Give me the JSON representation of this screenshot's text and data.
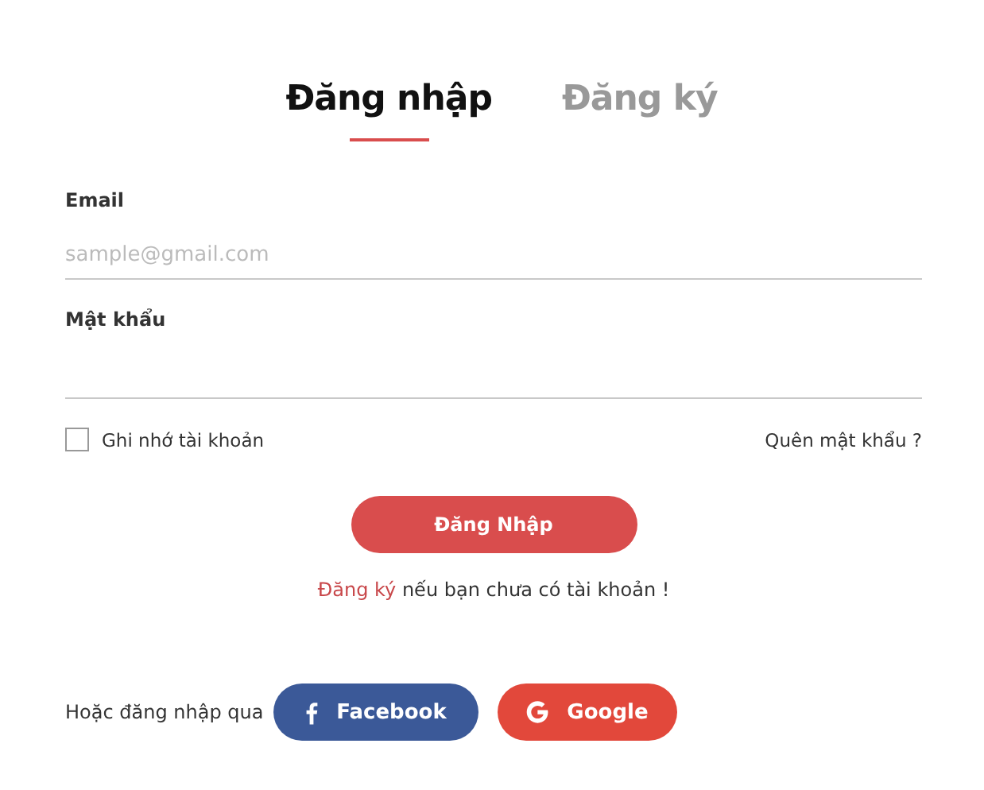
{
  "tabs": [
    {
      "label": "Đăng nhập",
      "selected": true
    },
    {
      "label": "Đăng ký",
      "selected": false
    }
  ],
  "fields": [
    {
      "label": "Email",
      "placeholder": "sample@gmail.com"
    },
    {
      "label": "Mật khẩu"
    }
  ],
  "remember": {
    "label": "Ghi nhớ tài khoản",
    "checked": false
  },
  "forgot_link": "Quên mật khẩu ?",
  "submit_button": "Đăng Nhập",
  "register_prompt": {
    "link": "Đăng ký",
    "text": "nếu bạn chưa có tài khoản !"
  },
  "social": {
    "label": "Hoặc đăng nhập qua",
    "buttons": [
      {
        "label": "Facebook",
        "kind": "facebook"
      },
      {
        "label": "Google",
        "kind": "google"
      }
    ]
  }
}
